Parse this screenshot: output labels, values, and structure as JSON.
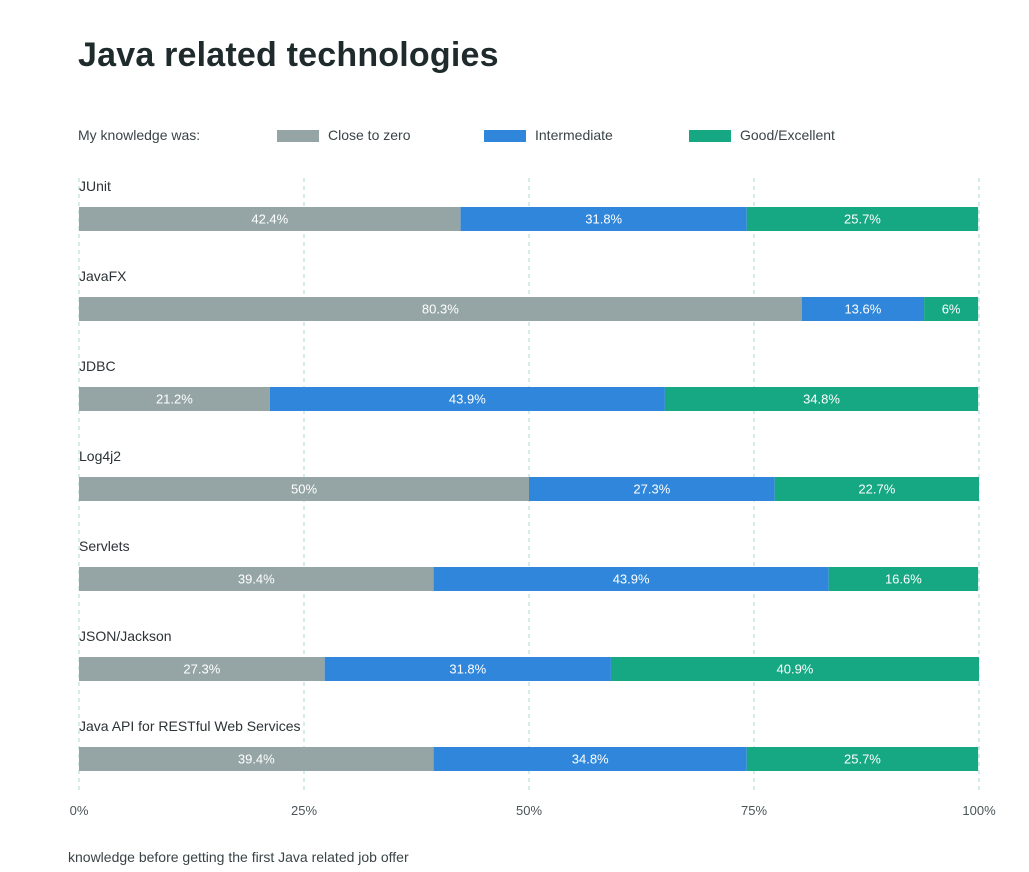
{
  "title": "Java related technologies",
  "legend_lead": "My knowledge was:",
  "footnote": "knowledge before getting the first Java related job offer",
  "colors": {
    "close_to_zero": "#95a5a6",
    "intermediate": "#2f86da",
    "good_excellent": "#16a883",
    "grid": "#b9dfe0"
  },
  "chart_data": {
    "type": "bar",
    "orientation": "horizontal",
    "stacked": true,
    "categories": [
      "JUnit",
      "JavaFX",
      "JDBC",
      "Log4j2",
      "Servlets",
      "JSON/Jackson",
      "Java API for RESTful Web Services"
    ],
    "series": [
      {
        "name": "Close to zero",
        "values": [
          42.4,
          80.3,
          21.2,
          50,
          39.4,
          27.3,
          39.4
        ],
        "labels": [
          "42.4%",
          "80.3%",
          "21.2%",
          "50%",
          "39.4%",
          "27.3%",
          "39.4%"
        ]
      },
      {
        "name": "Intermediate",
        "values": [
          31.8,
          13.6,
          43.9,
          27.3,
          43.9,
          31.8,
          34.8
        ],
        "labels": [
          "31.8%",
          "13.6%",
          "43.9%",
          "27.3%",
          "43.9%",
          "31.8%",
          "34.8%"
        ]
      },
      {
        "name": "Good/Excellent",
        "values": [
          25.7,
          6,
          34.8,
          22.7,
          16.6,
          40.9,
          25.7
        ],
        "labels": [
          "25.7%",
          "6%",
          "34.8%",
          "22.7%",
          "16.6%",
          "40.9%",
          "25.7%"
        ]
      }
    ],
    "xlim": [
      0,
      100
    ],
    "xticks": [
      "0%",
      "25%",
      "50%",
      "75%",
      "100%"
    ],
    "grid": true,
    "legend_position": "top"
  }
}
